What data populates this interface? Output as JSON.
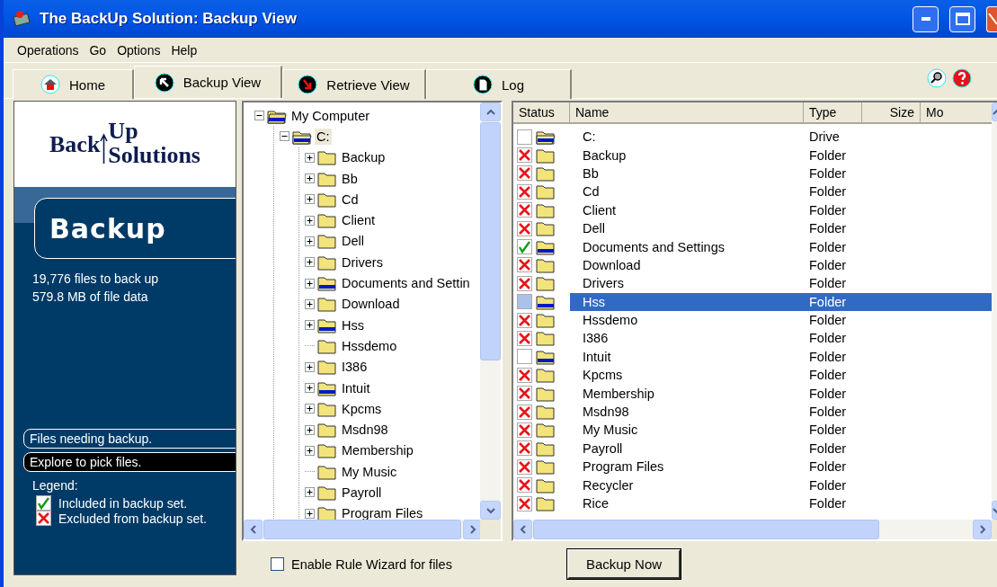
{
  "window": {
    "title": "The BackUp Solution:  Backup View"
  },
  "menu": [
    "Operations",
    "Go",
    "Options",
    "Help"
  ],
  "tabs": [
    {
      "label": "Home",
      "selected": false
    },
    {
      "label": "Backup View",
      "selected": true
    },
    {
      "label": "Retrieve View",
      "selected": false
    },
    {
      "label": "Log",
      "selected": false
    }
  ],
  "sidebar": {
    "logo": [
      "Back",
      "Up",
      "Solutions"
    ],
    "heading": "Backup",
    "stats": [
      "19,776 files to back up",
      "579.8 MB of file data"
    ],
    "actions": [
      {
        "label": "Files needing backup.",
        "selected": false
      },
      {
        "label": "Explore to pick files.",
        "selected": true
      }
    ],
    "legend_title": "Legend:",
    "legend": [
      {
        "kind": "included",
        "label": "Included in backup set."
      },
      {
        "kind": "excluded",
        "label": "Excluded from backup set."
      }
    ]
  },
  "tree": [
    {
      "label": "My Computer",
      "kind": "computer",
      "expanded": true,
      "partial": true,
      "selected": false,
      "children": [
        {
          "label": "C:",
          "kind": "drive",
          "expanded": true,
          "partial": true,
          "selected": true,
          "children": [
            {
              "label": "Backup",
              "kind": "folder",
              "expanded": false,
              "partial": false,
              "selected": false
            },
            {
              "label": "Bb",
              "kind": "folder",
              "expanded": false,
              "partial": false,
              "selected": false
            },
            {
              "label": "Cd",
              "kind": "folder",
              "expanded": false,
              "partial": false,
              "selected": false
            },
            {
              "label": "Client",
              "kind": "folder",
              "expanded": false,
              "partial": false,
              "selected": false
            },
            {
              "label": "Dell",
              "kind": "folder",
              "expanded": false,
              "partial": false,
              "selected": false
            },
            {
              "label": "Drivers",
              "kind": "folder",
              "expanded": false,
              "partial": false,
              "selected": false
            },
            {
              "label": "Documents and Settin",
              "kind": "folder",
              "expanded": false,
              "partial": true,
              "selected": false
            },
            {
              "label": "Download",
              "kind": "folder",
              "expanded": false,
              "partial": false,
              "selected": false
            },
            {
              "label": "Hss",
              "kind": "folder",
              "expanded": false,
              "partial": true,
              "selected": false
            },
            {
              "label": "Hssdemo",
              "kind": "folder",
              "partial": false,
              "selected": false
            },
            {
              "label": "I386",
              "kind": "folder",
              "expanded": false,
              "partial": false,
              "selected": false
            },
            {
              "label": "Intuit",
              "kind": "folder",
              "expanded": false,
              "partial": true,
              "selected": false
            },
            {
              "label": "Kpcms",
              "kind": "folder",
              "expanded": false,
              "partial": false,
              "selected": false
            },
            {
              "label": "Msdn98",
              "kind": "folder",
              "expanded": false,
              "partial": false,
              "selected": false
            },
            {
              "label": "Membership",
              "kind": "folder",
              "expanded": false,
              "partial": false,
              "selected": false
            },
            {
              "label": "My Music",
              "kind": "folder",
              "partial": false,
              "selected": false
            },
            {
              "label": "Payroll",
              "kind": "folder",
              "expanded": false,
              "partial": false,
              "selected": false
            },
            {
              "label": "Program Files",
              "kind": "folder",
              "expanded": false,
              "partial": false,
              "selected": false
            }
          ]
        }
      ]
    }
  ],
  "table": {
    "columns": [
      "Status",
      "Name",
      "Type",
      "Size",
      "Mo"
    ],
    "rows": [
      {
        "kind": "drive",
        "included": false,
        "excluded": false,
        "partial": true,
        "name": "C:",
        "type": "Drive",
        "selected": false
      },
      {
        "kind": "folder",
        "included": false,
        "excluded": true,
        "partial": false,
        "name": "Backup",
        "type": "Folder",
        "selected": false
      },
      {
        "kind": "folder",
        "included": false,
        "excluded": true,
        "partial": false,
        "name": "Bb",
        "type": "Folder",
        "selected": false
      },
      {
        "kind": "folder",
        "included": false,
        "excluded": true,
        "partial": false,
        "name": "Cd",
        "type": "Folder",
        "selected": false
      },
      {
        "kind": "folder",
        "included": false,
        "excluded": true,
        "partial": false,
        "name": "Client",
        "type": "Folder",
        "selected": false
      },
      {
        "kind": "folder",
        "included": false,
        "excluded": true,
        "partial": false,
        "name": "Dell",
        "type": "Folder",
        "selected": false
      },
      {
        "kind": "folder",
        "included": true,
        "excluded": false,
        "partial": true,
        "name": "Documents and Settings",
        "type": "Folder",
        "selected": false
      },
      {
        "kind": "folder",
        "included": false,
        "excluded": true,
        "partial": false,
        "name": "Download",
        "type": "Folder",
        "selected": false
      },
      {
        "kind": "folder",
        "included": false,
        "excluded": true,
        "partial": false,
        "name": "Drivers",
        "type": "Folder",
        "selected": false
      },
      {
        "kind": "folder",
        "included": false,
        "excluded": false,
        "partial": true,
        "name": "Hss",
        "type": "Folder",
        "selected": true
      },
      {
        "kind": "folder",
        "included": false,
        "excluded": true,
        "partial": false,
        "name": "Hssdemo",
        "type": "Folder",
        "selected": false
      },
      {
        "kind": "folder",
        "included": false,
        "excluded": true,
        "partial": false,
        "name": "I386",
        "type": "Folder",
        "selected": false
      },
      {
        "kind": "folder",
        "included": false,
        "excluded": false,
        "partial": true,
        "name": "Intuit",
        "type": "Folder",
        "selected": false
      },
      {
        "kind": "folder",
        "included": false,
        "excluded": true,
        "partial": false,
        "name": "Kpcms",
        "type": "Folder",
        "selected": false
      },
      {
        "kind": "folder",
        "included": false,
        "excluded": true,
        "partial": false,
        "name": "Membership",
        "type": "Folder",
        "selected": false
      },
      {
        "kind": "folder",
        "included": false,
        "excluded": true,
        "partial": false,
        "name": "Msdn98",
        "type": "Folder",
        "selected": false
      },
      {
        "kind": "folder",
        "included": false,
        "excluded": true,
        "partial": false,
        "name": "My Music",
        "type": "Folder",
        "selected": false
      },
      {
        "kind": "folder",
        "included": false,
        "excluded": true,
        "partial": false,
        "name": "Payroll",
        "type": "Folder",
        "selected": false
      },
      {
        "kind": "folder",
        "included": false,
        "excluded": true,
        "partial": false,
        "name": "Program Files",
        "type": "Folder",
        "selected": false
      },
      {
        "kind": "folder",
        "included": false,
        "excluded": true,
        "partial": false,
        "name": "Recycler",
        "type": "Folder",
        "selected": false
      },
      {
        "kind": "folder",
        "included": false,
        "excluded": true,
        "partial": false,
        "name": "Rice",
        "type": "Folder",
        "selected": false
      }
    ]
  },
  "rule_wizard": {
    "label": "Enable Rule Wizard for files",
    "checked": false
  },
  "backup_button": "Backup Now"
}
